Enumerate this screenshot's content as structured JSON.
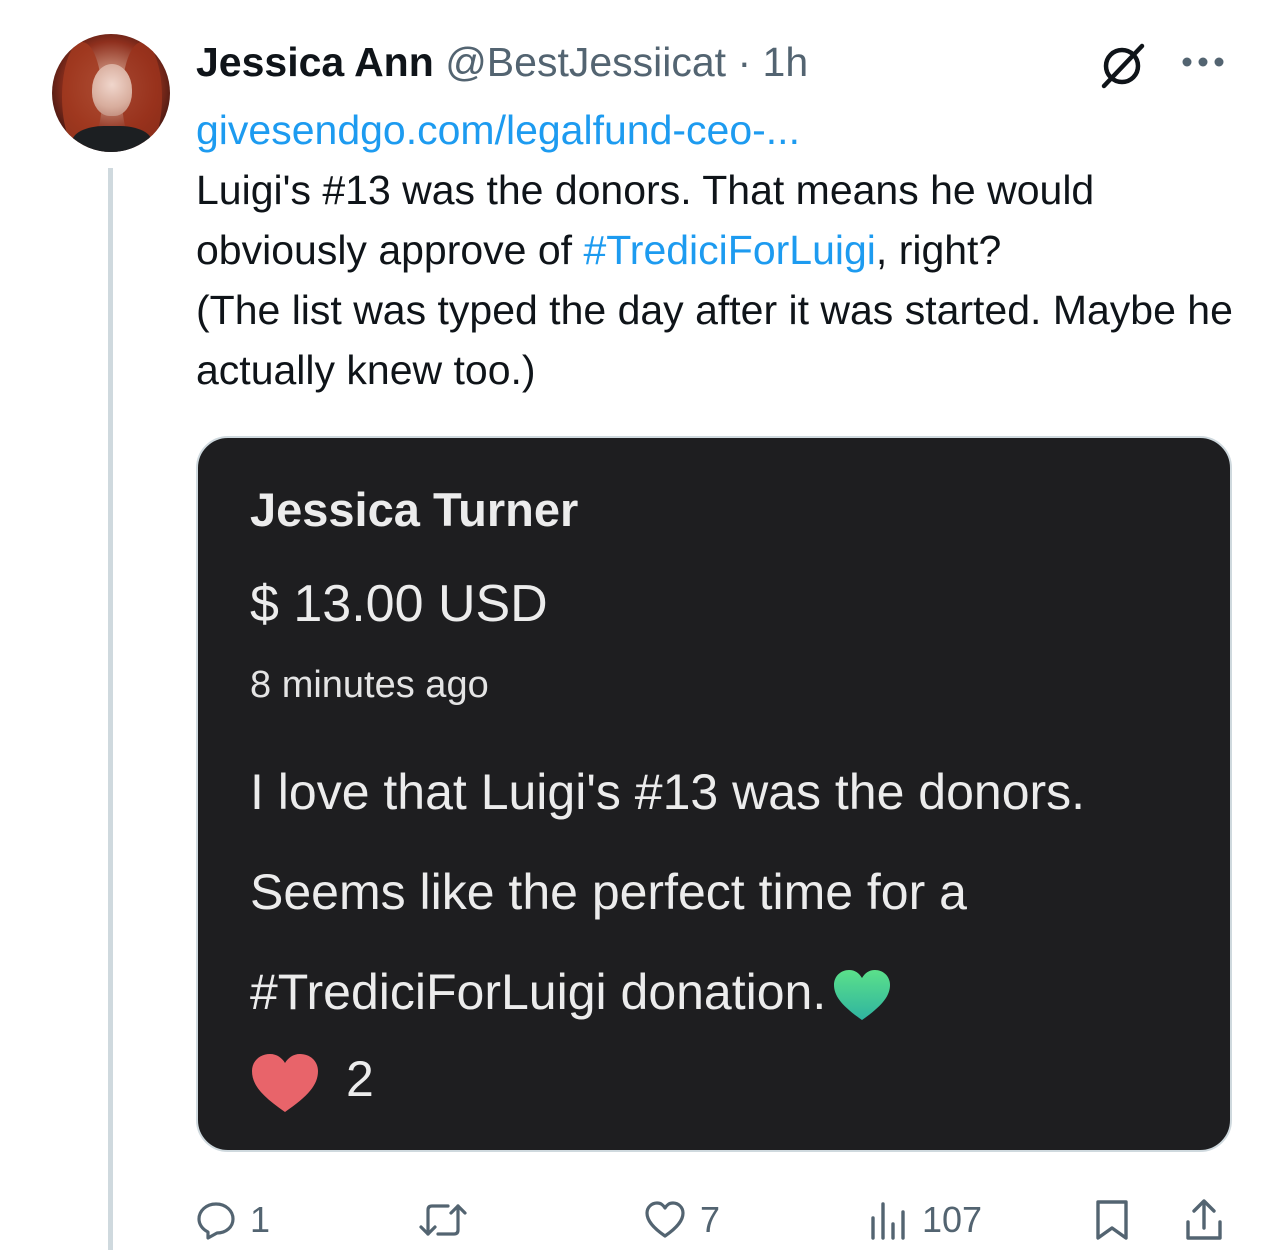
{
  "tweet": {
    "display_name": "Jessica Ann",
    "handle": "@BestJessiicat",
    "separator": "·",
    "time": "1h",
    "link_text": "givesendgo.com/legalfund-ceo-...",
    "text_part1": "Luigi's #13 was the donors. That means he would obviously approve of ",
    "hashtag": "#TrediciForLuigi",
    "text_part2": ", right?",
    "text_line3": "(The list was typed the day after it was started. Maybe he actually knew too.)"
  },
  "media": {
    "donor_name": "Jessica Turner",
    "amount": "$ 13.00 USD",
    "time_ago": "8 minutes ago",
    "message_line1": "I love that Luigi's #13 was the donors.",
    "message_line2": "Seems like the perfect time for a",
    "message_line3": "#TrediciForLuigi donation.",
    "like_count": "2",
    "icons": [
      "green-heart-icon",
      "red-heart-icon"
    ]
  },
  "actions": {
    "replies": "1",
    "reposts": "",
    "likes": "7",
    "views": "107"
  },
  "colors": {
    "link": "#1d9bf0",
    "secondary_text": "#536471",
    "media_bg": "#1e1e20",
    "thread_line": "#cfd9de"
  }
}
